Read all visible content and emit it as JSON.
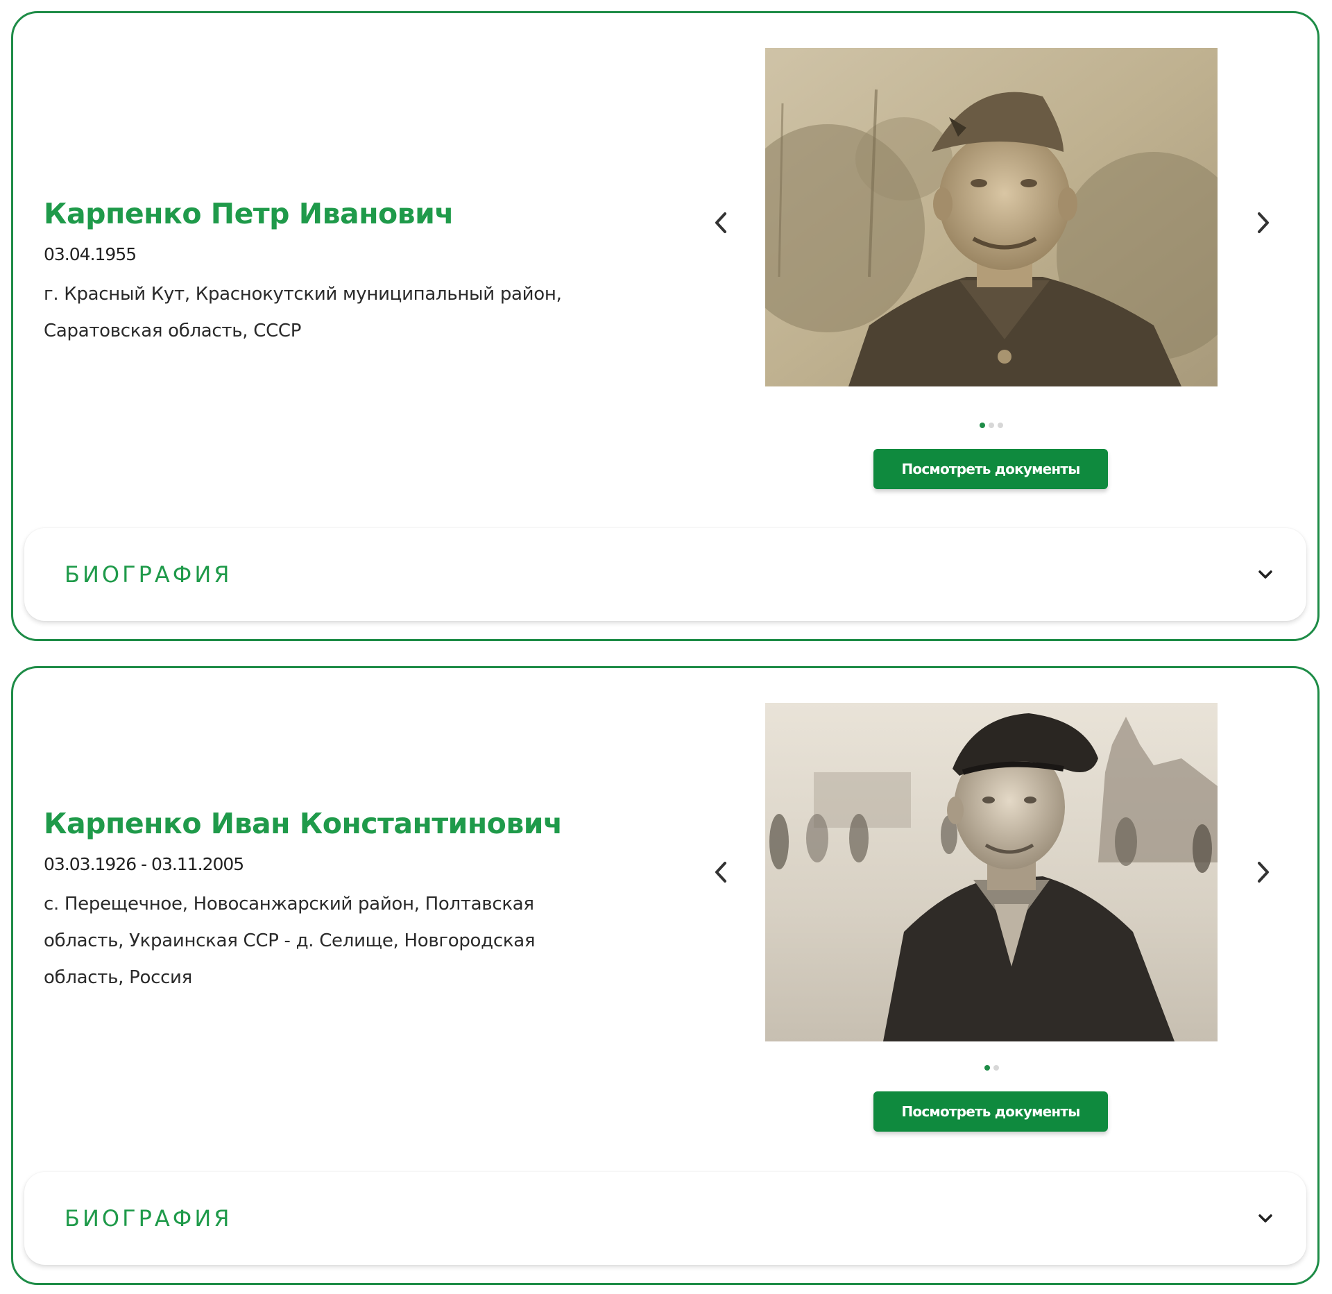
{
  "people": [
    {
      "name": "Карпенко Петр Иванович",
      "dates": "03.04.1955",
      "place_lines": [
        "г. Красный Кут, Краснокутский муниципальный район,",
        "Саратовская область, СССР"
      ],
      "photos_count": 3,
      "active_photo_index": 0,
      "docs_button_label": "Посмотреть документы",
      "bio_label": "БИОГРАФИЯ"
    },
    {
      "name": "Карпенко Иван Константинович",
      "dates": "03.03.1926 - 03.11.2005",
      "place_lines": [
        "с. Перещечное, Новосанжарский район, Полтавская",
        "область, Украинская ССР - д. Селище, Новгородская",
        "область, Россия"
      ],
      "photos_count": 2,
      "active_photo_index": 0,
      "docs_button_label": "Посмотреть документы",
      "bio_label": "БИОГРАФИЯ"
    }
  ],
  "icons": {
    "prev": "chevron-left-icon",
    "next": "chevron-right-icon",
    "expand": "chevron-down-icon"
  },
  "colors": {
    "accent": "#1f9a4a",
    "border": "#1e8c47",
    "button": "#0f8a3e"
  }
}
